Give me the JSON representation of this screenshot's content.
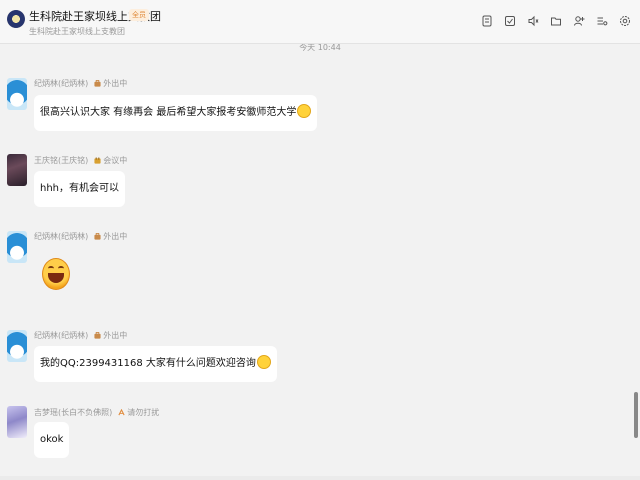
{
  "header": {
    "title": "生科院赴王家坝线上支教团",
    "tag": "全员",
    "subtitle": "生科院赴王家坝线上支教团",
    "toolbar_icons": [
      "chat-history-icon",
      "task-icon",
      "voice-icon",
      "folder-icon",
      "add-member-icon",
      "more-apps-icon",
      "settings-icon"
    ]
  },
  "chat": {
    "time_separator": "今天 10:44",
    "messages": [
      {
        "sender": "纪炳林(纪炳林)",
        "status": "外出中",
        "text": "很高兴认识大家 有缘再会 最后希望大家报考安徽师范大学"
      },
      {
        "sender": "王庆铭(王庆铭)",
        "status": "会议中",
        "text": "hhh，有机会可以"
      },
      {
        "sender": "纪炳林(纪炳林)",
        "status": "外出中"
      },
      {
        "sender": "纪炳林(纪炳林)",
        "status": "外出中",
        "text": "我的QQ:2399431168 大家有什么问题欢迎咨询"
      },
      {
        "sender": "吉梦瑶(长白不负佛照)",
        "status": "请勿打扰",
        "text": "okok"
      }
    ]
  },
  "colors": {
    "background": "#f2f2f2",
    "bubble": "#ffffff",
    "meta_text": "#999999",
    "tag_text": "#e08a3a"
  }
}
